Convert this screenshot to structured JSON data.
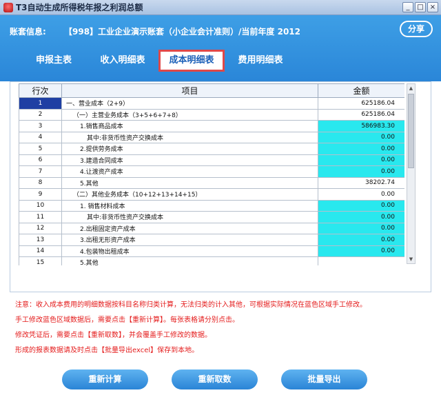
{
  "window": {
    "title": "T3自动生成所得税年报之利润总额",
    "min": "_",
    "max": "□",
    "close": "×"
  },
  "header": {
    "account_label": "账套信息:",
    "account_info": "【998】工业企业演示账套（小企业会计准则）/当前年度 2012",
    "share_label": "分享"
  },
  "tabs": [
    {
      "label": "申报主表",
      "active": false
    },
    {
      "label": "收入明细表",
      "active": false
    },
    {
      "label": "成本明细表",
      "active": true
    },
    {
      "label": "费用明细表",
      "active": false
    }
  ],
  "table": {
    "columns": [
      "行次",
      "项目",
      "金额"
    ],
    "rows": [
      {
        "idx": "1",
        "item": "一、营业成本（2+9）",
        "amount": "625186.04",
        "editable": false
      },
      {
        "idx": "2",
        "item": "（一）主营业务成本（3+5+6+7+8）",
        "amount": "625186.04",
        "editable": false
      },
      {
        "idx": "3",
        "item": "1.销售商品成本",
        "amount": "586983.30",
        "editable": true
      },
      {
        "idx": "4",
        "item": "其中:非货币性资产交换成本",
        "amount": "0.00",
        "editable": true
      },
      {
        "idx": "5",
        "item": "2.提供劳务成本",
        "amount": "0.00",
        "editable": true
      },
      {
        "idx": "6",
        "item": "3.建造合同成本",
        "amount": "0.00",
        "editable": true
      },
      {
        "idx": "7",
        "item": "4.让渡资产成本",
        "amount": "0.00",
        "editable": true
      },
      {
        "idx": "8",
        "item": "5.其他",
        "amount": "38202.74",
        "editable": false
      },
      {
        "idx": "9",
        "item": "（二）其他业务成本（10+12+13+14+15）",
        "amount": "0.00",
        "editable": false
      },
      {
        "idx": "10",
        "item": "1. 销售材料成本",
        "amount": "0.00",
        "editable": true
      },
      {
        "idx": "11",
        "item": "其中:非货币性资产交换成本",
        "amount": "0.00",
        "editable": true
      },
      {
        "idx": "12",
        "item": "2.出租固定资产成本",
        "amount": "0.00",
        "editable": true
      },
      {
        "idx": "13",
        "item": "3.出租无形资产成本",
        "amount": "0.00",
        "editable": true
      },
      {
        "idx": "14",
        "item": "4.包装物出租成本",
        "amount": "0.00",
        "editable": true
      },
      {
        "idx": "15",
        "item": "5.其他",
        "amount": "",
        "editable": false
      }
    ]
  },
  "notes": [
    "注意：收入成本费用的明细数据按科目名称归类计算，无法归类的计入其他，可根据实际情况在蓝色区域手工修改。",
    "手工修改蓝色区域数据后，需要点击【重新计算】。每张表格请分别点击。",
    "修改凭证后，需要点击【重新取数】，并会覆盖手工修改的数据。",
    "形成的报表数据请及时点击【批量导出excel】保存到本地。"
  ],
  "buttons": {
    "recalc": "重新计算",
    "refetch": "重新取数",
    "export": "批量导出"
  },
  "colors": {
    "header_blue": "#2a86d8",
    "editable_cyan": "#29e8ee",
    "note_red": "#e41b1b",
    "selected_row": "#1f3fa3"
  }
}
